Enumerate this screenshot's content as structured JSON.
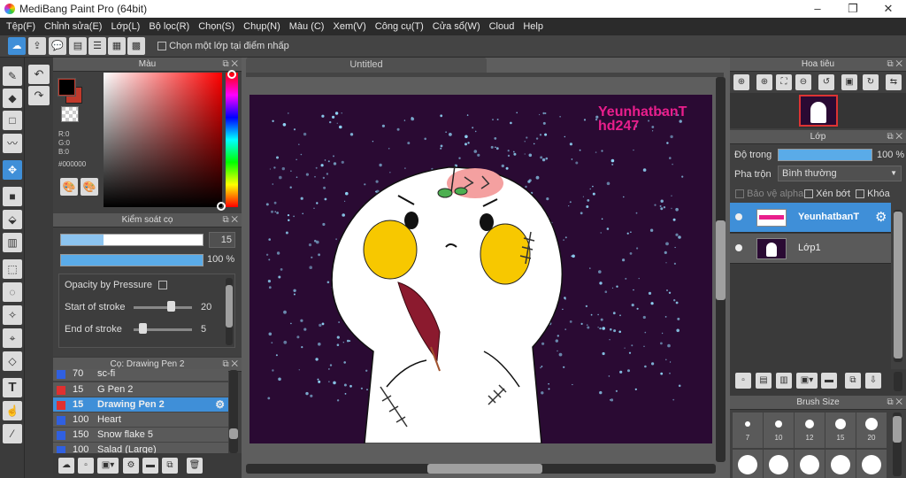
{
  "window": {
    "title": "MediBang Paint Pro (64bit)",
    "minimize": "–",
    "maximize": "❐",
    "close": "✕"
  },
  "menu": [
    "Tệp(F)",
    "Chỉnh sửa(E)",
    "Lớp(L)",
    "Bộ lọc(R)",
    "Chọn(S)",
    "Chụp(N)",
    "Màu (C)",
    "Xem(V)",
    "Công cụ(T)",
    "Cửa sổ(W)",
    "Cloud",
    "Help"
  ],
  "toolbar": {
    "select_one_layer_label": "Chọn một lớp tại điểm nhấp"
  },
  "color_panel": {
    "title": "Màu",
    "r": "R:0",
    "g": "G:0",
    "b": "B:0",
    "hex": "#000000",
    "primary_color": "#000000",
    "secondary_color": "#c0392b",
    "picker_hue": "#ff0000"
  },
  "brush_control": {
    "title": "Kiểm soát cọ",
    "size_value": "15",
    "opacity_value": "100 %",
    "opacity_by_pressure": "Opacity by Pressure",
    "start_of_stroke": "Start of stroke",
    "start_value": "20",
    "end_of_stroke": "End of stroke",
    "end_value": "5"
  },
  "brush_list": {
    "title": "Cọ: Drawing Pen 2",
    "items": [
      {
        "size": "70",
        "name": "sc-fi",
        "color": "#3060e0"
      },
      {
        "size": "15",
        "name": "G Pen 2",
        "color": "#e03030"
      },
      {
        "size": "15",
        "name": "Drawing Pen 2",
        "color": "#e03030"
      },
      {
        "size": "100",
        "name": "Heart",
        "color": "#3060e0"
      },
      {
        "size": "150",
        "name": "Snow flake 5",
        "color": "#3060e0"
      },
      {
        "size": "100",
        "name": "Salad (Large)",
        "color": "#3060e0"
      }
    ]
  },
  "canvas": {
    "tab_title": "Untitled",
    "watermark_line1": "YeunhatbanT",
    "watermark_line2": "hd247",
    "bg": "#2a0a33"
  },
  "navigator": {
    "title": "Hoa tiêu"
  },
  "layer_panel": {
    "title": "Lớp",
    "opacity_label": "Độ trong",
    "opacity_value": "100 %",
    "blend_label": "Pha trộn",
    "blend_value": "Bình thường",
    "protect_alpha": "Bảo vệ alpha",
    "clipping": "Xén bớt",
    "lock": "Khóa",
    "layers": [
      {
        "name": "YeunhatbanT",
        "selected": true
      },
      {
        "name": "Lớp1",
        "selected": false
      }
    ]
  },
  "brush_size": {
    "title": "Brush Size",
    "sizes": [
      "7",
      "10",
      "12",
      "15",
      "20"
    ]
  },
  "accent": "#3f8fd8"
}
